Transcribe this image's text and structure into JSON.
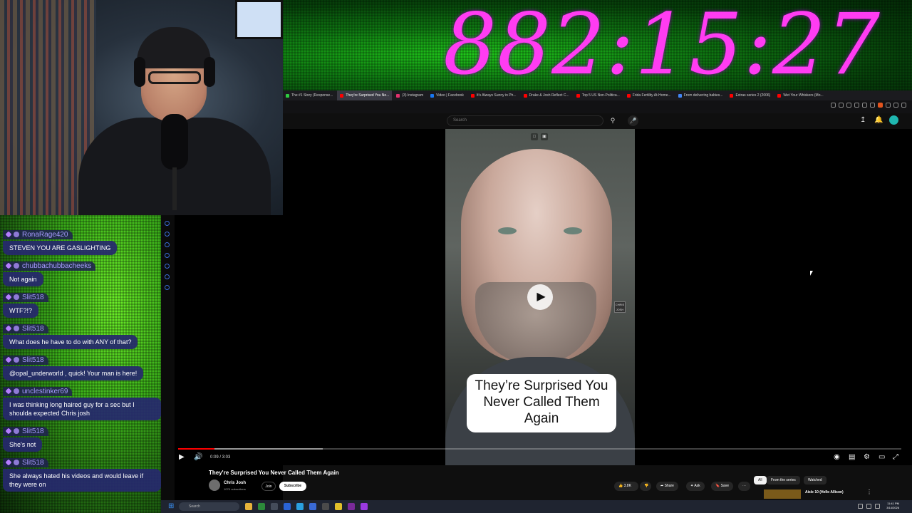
{
  "overlay": {
    "countdown": "882:15:27"
  },
  "chat": {
    "messages": [
      {
        "user": "RonaRage420",
        "text": "STEVEN YOU ARE GASLIGHTING"
      },
      {
        "user": "chubbachubbacheeks",
        "text": "Not again"
      },
      {
        "user": "Slit518",
        "text": "WTF?!?"
      },
      {
        "user": "Slit518",
        "text": "What does he have to do with ANY of that?"
      },
      {
        "user": "Slit518",
        "text": "@opal_underworld , quick! Your man is here!"
      },
      {
        "user": "unclestinker69",
        "text": "I was thinking long haired guy for a sec but I shoulda expected Chris josh"
      },
      {
        "user": "Slit518",
        "text": "She's not"
      },
      {
        "user": "Slit518",
        "text": "She always hated his videos and would leave if they were on"
      }
    ]
  },
  "browser": {
    "tabs": [
      {
        "label": "The #1 Story (Response...",
        "color": "#2ecc40",
        "active": false
      },
      {
        "label": "They're Surprised You Ne...",
        "color": "#ff0000",
        "active": true
      },
      {
        "label": "(3) Instagram",
        "color": "#e1306c",
        "active": false
      },
      {
        "label": "Video | Facebook",
        "color": "#1877f2",
        "active": false
      },
      {
        "label": "It's Always Sunny in Ph...",
        "color": "#ff0000",
        "active": false
      },
      {
        "label": "Drake & Josh Reflect C...",
        "color": "#ff0000",
        "active": false
      },
      {
        "label": "Top 5 US Non-Politica...",
        "color": "#ff0000",
        "active": false
      },
      {
        "label": "Frida Fertility At-Home...",
        "color": "#ff0000",
        "active": false
      },
      {
        "label": "From delivering babies...",
        "color": "#4285f4",
        "active": false
      },
      {
        "label": "Extras series 2 (2006)",
        "color": "#ff0000",
        "active": false
      },
      {
        "label": "Wet Your Whiskers (Mo...",
        "color": "#ff0000",
        "active": false
      }
    ]
  },
  "youtube": {
    "search_placeholder": "Search",
    "video": {
      "caption": "They’re Surprised You Never Called Them Again",
      "time": "0:09 / 3:03",
      "progress": 0.05,
      "buffered": 0.2
    },
    "title": "They're Surprised You Never Called Them Again",
    "channel": {
      "name": "Chris Josh",
      "subscribers": "107K subscribers",
      "join_label": "Join",
      "subscribe_label": "Subscribe"
    },
    "actions": {
      "likes": "3.8K",
      "share": "Share",
      "ask": "Ask",
      "save": "Save"
    },
    "chips": [
      "All",
      "From the series",
      "Watched"
    ],
    "recommended": {
      "title": "Aisle 10 (Hello Allison)"
    }
  },
  "taskbar": {
    "search_placeholder": "Search",
    "time": "11:41 PM",
    "date": "3/14/2026"
  }
}
